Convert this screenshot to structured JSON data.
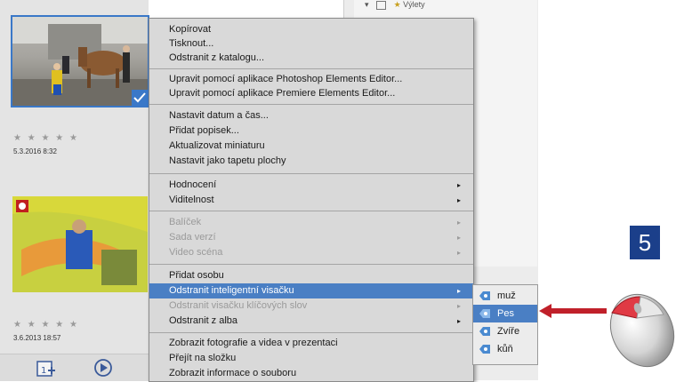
{
  "top_fragment": {
    "label": "Výlety"
  },
  "thumbnails": [
    {
      "stars": "★ ★ ★ ★ ★",
      "date": "5.3.2016 8:32"
    },
    {
      "stars": "★ ★ ★ ★ ★",
      "date": "3.6.2013 18:57"
    }
  ],
  "menu": {
    "group1": [
      "Kopírovat",
      "Tisknout...",
      "Odstranit z katalogu..."
    ],
    "group2": [
      "Upravit pomocí aplikace Photoshop Elements Editor...",
      "Upravit pomocí aplikace Premiere Elements Editor..."
    ],
    "group3": [
      "Nastavit datum a čas...",
      "Přidat popisek...",
      "Aktualizovat miniaturu",
      "Nastavit jako tapetu plochy"
    ],
    "group4": [
      "Hodnocení",
      "Viditelnost"
    ],
    "group5": [
      "Balíček",
      "Sada verzí",
      "Video scéna"
    ],
    "group6": [
      "Přidat osobu",
      "Odstranit inteligentní visačku",
      "Odstranit visačku klíčových slov",
      "Odstranit z alba"
    ],
    "group7": [
      "Zobrazit fotografie a videa v prezentaci",
      "Přejít na složku",
      "Zobrazit informace o souboru"
    ]
  },
  "submenu": [
    "muž",
    "Pes",
    "Zvíře",
    "kůň"
  ],
  "step_number": "5",
  "colors": {
    "highlight": "#4a7fc4",
    "step_badge": "#1b3f8a",
    "arrow": "#c0202a"
  }
}
